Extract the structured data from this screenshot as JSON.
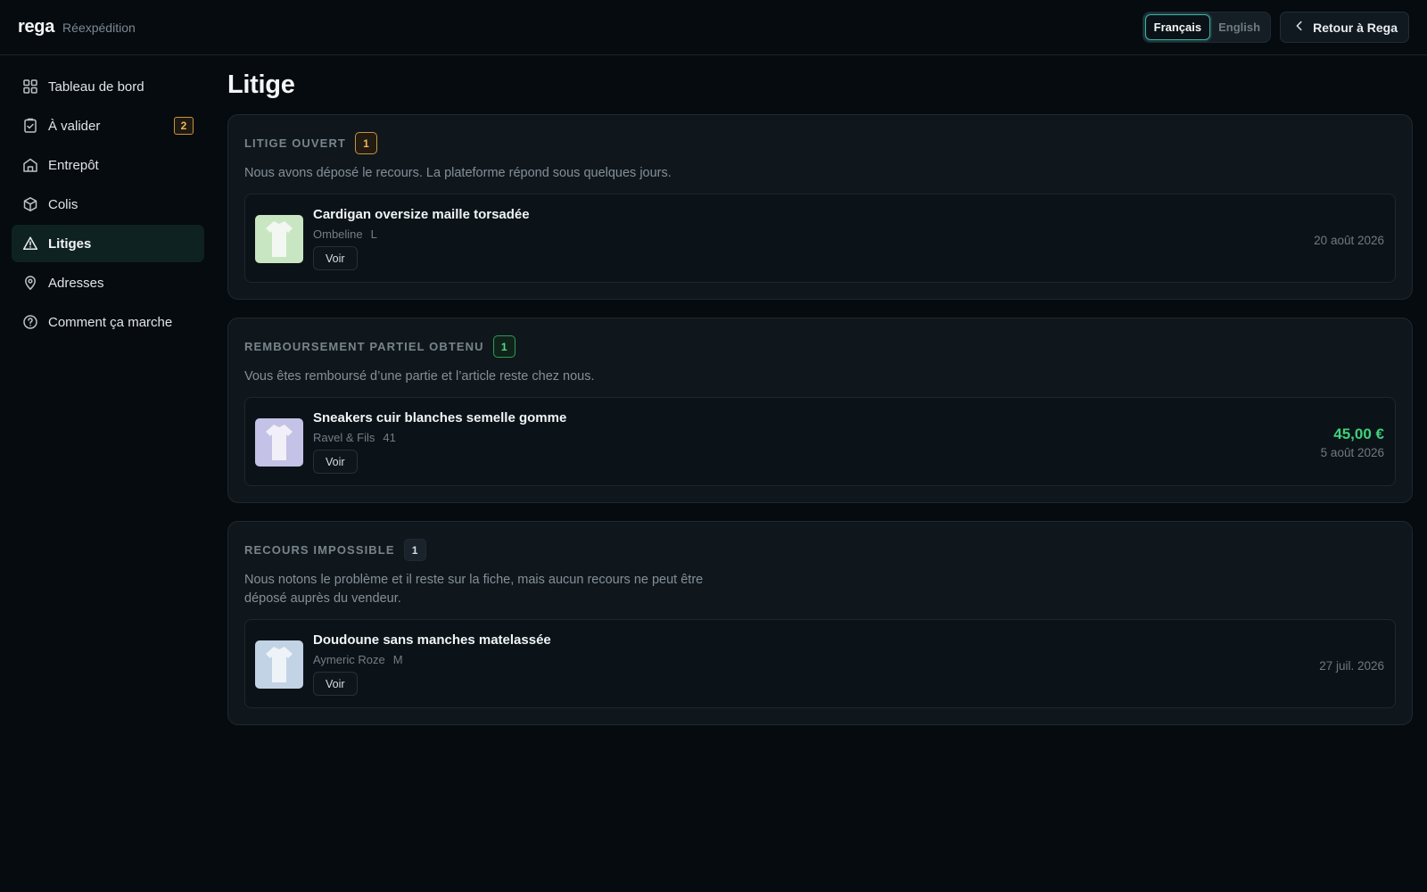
{
  "header": {
    "brand": "rega",
    "subtitle": "Réexpédition",
    "languages": [
      {
        "label": "Français",
        "active": true
      },
      {
        "label": "English",
        "active": false
      }
    ],
    "back_label": "Retour à Rega"
  },
  "sidebar": {
    "items": [
      {
        "label": "Tableau de bord",
        "icon": "grid-icon"
      },
      {
        "label": "À valider",
        "icon": "clipboard-check-icon",
        "badge": "2"
      },
      {
        "label": "Entrepôt",
        "icon": "warehouse-icon"
      },
      {
        "label": "Colis",
        "icon": "package-icon"
      },
      {
        "label": "Litiges",
        "icon": "alert-triangle-icon",
        "active": true
      },
      {
        "label": "Adresses",
        "icon": "map-pin-icon"
      },
      {
        "label": "Comment ça marche",
        "icon": "help-circle-icon"
      }
    ]
  },
  "main": {
    "title": "Litige",
    "sections": [
      {
        "title": "LITIGE OUVERT",
        "count": "1",
        "desc": "Nous avons déposé le recours. La plateforme répond sous quelques jours.",
        "items": [
          {
            "name": "Cardigan oversize maille torsadée",
            "seller": "Ombeline",
            "size": "L",
            "voir": "Voir",
            "date": "20 août 2026",
            "thumb_bg": "#c9e6c2"
          }
        ]
      },
      {
        "title": "REMBOURSEMENT PARTIEL OBTENU",
        "count": "1",
        "desc": "Vous êtes remboursé d’une partie et l’article reste chez nous.",
        "items": [
          {
            "name": "Sneakers cuir blanches semelle gomme",
            "seller": "Ravel & Fils",
            "size": "41",
            "voir": "Voir",
            "amount": "45,00 €",
            "date": "5 août 2026",
            "thumb_bg": "#c4c2e6"
          }
        ]
      },
      {
        "title": "RECOURS IMPOSSIBLE",
        "count": "1",
        "desc_line1": "Nous notons le problème et il reste sur la fiche, mais aucun recours ne peut être",
        "desc_line2": "déposé auprès du vendeur.",
        "items": [
          {
            "name": "Doudoune sans manches matelassée",
            "seller": "Aymeric Roze",
            "size": "M",
            "voir": "Voir",
            "date": "27 juil. 2026",
            "thumb_bg": "#c2d3e6"
          }
        ]
      }
    ]
  },
  "colors": {
    "accent": "#3bb4a6",
    "amber": "#f0b65a",
    "green": "#3fd17a"
  }
}
